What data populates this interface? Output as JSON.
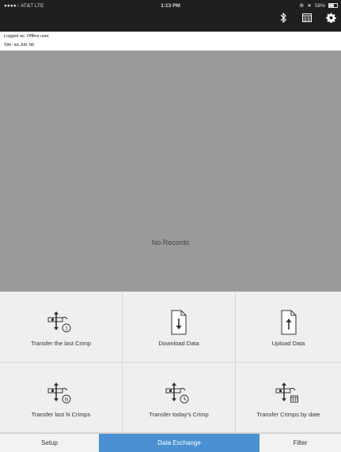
{
  "status_bar": {
    "carrier": "●●●●○ AT&T  LTE",
    "time": "1:13 PM",
    "battery_text": "58%",
    "battery_level": 0.58
  },
  "header": {
    "icons": [
      "bluetooth-icon",
      "calendar-icon",
      "gear-icon"
    ]
  },
  "info": {
    "logged_as": "Logged as: Offline user",
    "site_job": "Site: aa Job: bb"
  },
  "records": {
    "empty_text": "No Records"
  },
  "actions": [
    {
      "label": "Transfer the last Crimp",
      "icon": "transfer-last-icon"
    },
    {
      "label": "Download Data",
      "icon": "download-file-icon"
    },
    {
      "label": "Upload Data",
      "icon": "upload-file-icon"
    },
    {
      "label": "Transfer last N Crimps",
      "icon": "transfer-n-icon",
      "badge": "N"
    },
    {
      "label": "Transfer today's Crimp",
      "icon": "transfer-today-icon"
    },
    {
      "label": "Transfer Crimps by date",
      "icon": "transfer-by-date-icon"
    }
  ],
  "tabs": [
    {
      "label": "Setup",
      "active": false
    },
    {
      "label": "Data Exchange",
      "active": true
    },
    {
      "label": "Filter",
      "active": false
    }
  ],
  "colors": {
    "header_bg": "#1f1f1f",
    "records_bg": "#9a9a9a",
    "grid_bg": "#efefef",
    "active_tab": "#4a90d2"
  }
}
